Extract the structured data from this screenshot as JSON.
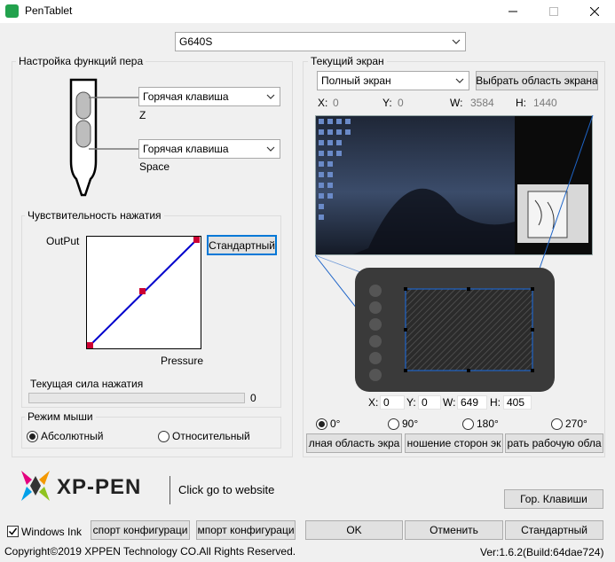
{
  "window": {
    "title": "PenTablet"
  },
  "device": {
    "selected": "G640S"
  },
  "pen": {
    "group_label": "Настройка функций пера",
    "upper_select": "Горячая клавиша",
    "upper_value": "Z",
    "lower_select": "Горячая клавиша",
    "lower_value": "Space"
  },
  "pressure": {
    "group_label": "Чувствительность нажатия",
    "output_label": "OutPut",
    "pressure_label": "Pressure",
    "standard_button": "Стандартный",
    "current_label": "Текущая сила нажатия",
    "current_value": "0"
  },
  "mouse": {
    "group_label": "Режим мыши",
    "absolute": "Абсолютный",
    "relative": "Относительный"
  },
  "screen": {
    "group_label": "Текущий экран",
    "select": "Полный экран",
    "choose_button": "Выбрать область экрана",
    "x_label": "X:",
    "x_value": "0",
    "y_label": "Y:",
    "y_value": "0",
    "w_label": "W:",
    "w_value": "3584",
    "h_label": "H:",
    "h_value": "1440"
  },
  "tablet": {
    "x_label": "X:",
    "x_value": "0",
    "y_label": "Y:",
    "y_value": "0",
    "w_label": "W:",
    "w_value": "649",
    "h_label": "H:",
    "h_value": "405"
  },
  "rotation": {
    "r0": "0°",
    "r90": "90°",
    "r180": "180°",
    "r270": "270°"
  },
  "area_buttons": {
    "full": "лная область экра",
    "ratio": "ношение сторон эк",
    "work": "рать рабочую обла"
  },
  "brand": {
    "logo_text": "XP-PEN",
    "website_link": "Click go to website"
  },
  "hotkeys_button": "Гор. Клавиши",
  "bottom": {
    "windows_ink": "Windows Ink",
    "export": "спорт конфигураци",
    "import": "мпорт  конфигураци",
    "ok": "OK",
    "cancel": "Отменить",
    "standard": "Стандартный"
  },
  "footer": {
    "copyright": "Copyright©2019  XPPEN Technology CO.All Rights Reserved.",
    "version": "Ver:1.6.2(Build:64dae724)"
  },
  "colors": {
    "accent": "#0078d7",
    "curve": "#0000cc",
    "curve_points": "#cc0033",
    "tablet_body": "#3a3a3a"
  }
}
